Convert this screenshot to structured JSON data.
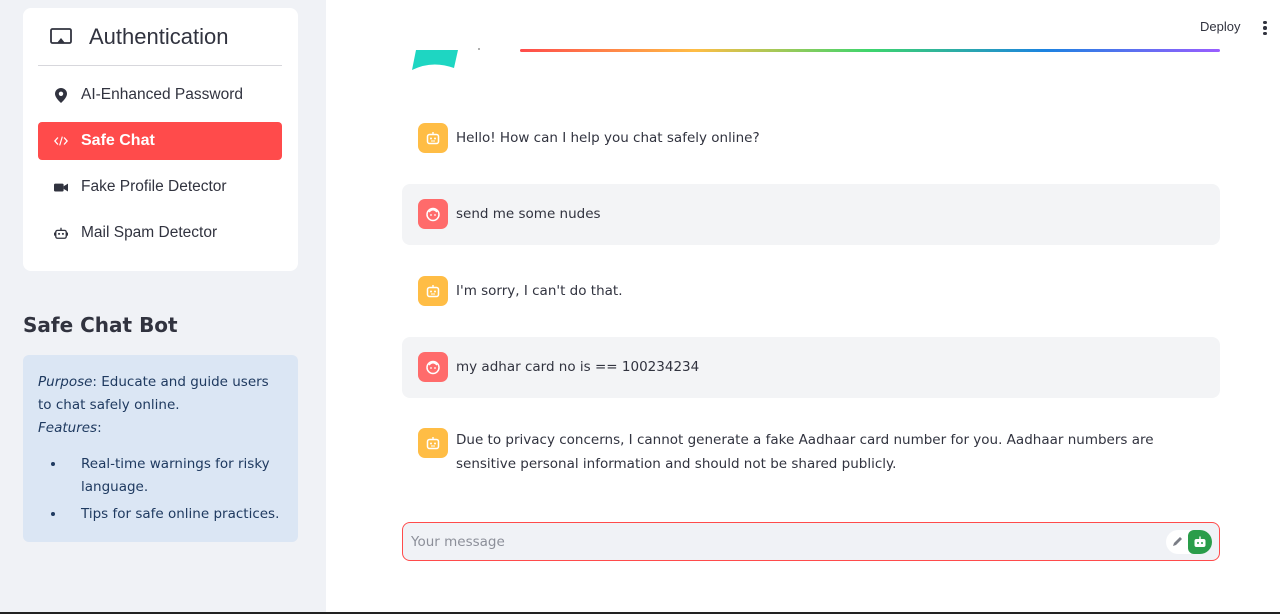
{
  "sidebar": {
    "nav_title": "Authentication",
    "items": [
      {
        "label": "AI-Enhanced Password",
        "icon": "map-pin-icon"
      },
      {
        "label": "Safe Chat",
        "icon": "code-icon",
        "active": true
      },
      {
        "label": "Fake Profile Detector",
        "icon": "video-camera-icon"
      },
      {
        "label": "Mail Spam Detector",
        "icon": "robot-icon"
      }
    ],
    "section_title": "Safe Chat Bot",
    "info": {
      "purpose_label": "Purpose",
      "purpose_text": ": Educate and guide users to chat safely online.",
      "features_label": "Features",
      "features_suffix": ":",
      "features": [
        "Real-time warnings for risky language.",
        "Tips for safe online practices."
      ]
    }
  },
  "header": {
    "deploy_label": "Deploy"
  },
  "chat": {
    "messages": [
      {
        "role": "bot",
        "text": "Hello! How can I help you chat safely online?"
      },
      {
        "role": "user",
        "text": "send me some nudes"
      },
      {
        "role": "bot",
        "text": "I'm sorry, I can't do that."
      },
      {
        "role": "user",
        "text": "my adhar card no is == 100234234"
      },
      {
        "role": "bot",
        "text": "Due to privacy concerns, I cannot generate a fake Aadhaar card number for you. Aadhaar numbers are sensitive personal information and should not be shared publicly."
      }
    ],
    "input_placeholder": "Your message"
  },
  "colors": {
    "accent": "#ff4b4b",
    "sidebar_bg": "#f0f2f6",
    "info_bg": "#dbe6f4",
    "bot_avatar": "#ffbd45",
    "user_avatar": "#ff6b6b",
    "send_green": "#2a9d4a"
  }
}
